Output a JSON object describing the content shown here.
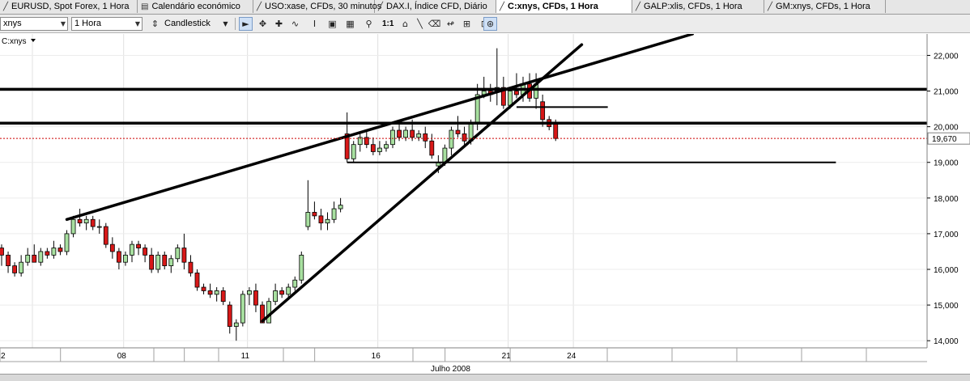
{
  "tabs": [
    {
      "label": "EURUSD, Spot Forex, 1 Hora",
      "icon": "chart-icon",
      "active": false
    },
    {
      "label": "Calendário económico",
      "icon": "calendar-icon",
      "active": false
    },
    {
      "label": "USO:xase, CFDs, 30 minutos",
      "icon": "chart-icon",
      "active": false
    },
    {
      "label": "DAX.I, Índice CFD, Diário",
      "icon": "chart-icon",
      "active": false
    },
    {
      "label": "C:xnys, CFDs, 1 Hora",
      "icon": "chart-icon",
      "active": true
    },
    {
      "label": "GALP:xlis, CFDs, 1 Hora",
      "icon": "chart-icon",
      "active": false
    },
    {
      "label": "GM:xnys, CFDs, 1 Hora",
      "icon": "chart-icon",
      "active": false
    }
  ],
  "toolbar": {
    "symbol": "xnys",
    "timeframe": "1 Hora",
    "chart_type": "Candlestick",
    "zoom_ratio": "1:1"
  },
  "chart_data": {
    "type": "candlestick",
    "symbol_label": "C:xnys",
    "ylim": [
      13.8,
      22.6
    ],
    "y_ticks": [
      "22,000",
      "21,000",
      "20,000",
      "19,000",
      "18,000",
      "17,000",
      "16,000",
      "15,000",
      "14,000"
    ],
    "y_tick_values": [
      22,
      21,
      20,
      19,
      18,
      17,
      16,
      15,
      14
    ],
    "x_tick_labels": [
      "2",
      "08",
      "11",
      "16",
      "21",
      "24"
    ],
    "x_tick_index": [
      0,
      14,
      33,
      53,
      73,
      83
    ],
    "month_label": "Julho 2008",
    "current_price": 19.67,
    "current_price_label": "19,670",
    "colors": {
      "up": "#a8e0a0",
      "down": "#d81818",
      "price_line": "#cc0000",
      "drawing": "#000000"
    },
    "candles": [
      {
        "o": 16.6,
        "h": 16.7,
        "l": 16.1,
        "c": 16.4
      },
      {
        "o": 16.4,
        "h": 16.5,
        "l": 15.9,
        "c": 16.1
      },
      {
        "o": 16.1,
        "h": 16.2,
        "l": 15.8,
        "c": 15.9
      },
      {
        "o": 15.9,
        "h": 16.4,
        "l": 15.8,
        "c": 16.2
      },
      {
        "o": 16.2,
        "h": 16.6,
        "l": 16.1,
        "c": 16.4
      },
      {
        "o": 16.4,
        "h": 16.7,
        "l": 16.2,
        "c": 16.2
      },
      {
        "o": 16.2,
        "h": 16.6,
        "l": 16.1,
        "c": 16.5
      },
      {
        "o": 16.5,
        "h": 16.6,
        "l": 16.3,
        "c": 16.4
      },
      {
        "o": 16.4,
        "h": 16.8,
        "l": 16.3,
        "c": 16.6
      },
      {
        "o": 16.6,
        "h": 16.7,
        "l": 16.4,
        "c": 16.5
      },
      {
        "o": 16.5,
        "h": 17.1,
        "l": 16.4,
        "c": 17.0
      },
      {
        "o": 17.0,
        "h": 17.5,
        "l": 16.9,
        "c": 17.4
      },
      {
        "o": 17.4,
        "h": 17.7,
        "l": 17.2,
        "c": 17.3
      },
      {
        "o": 17.3,
        "h": 17.5,
        "l": 17.1,
        "c": 17.4
      },
      {
        "o": 17.4,
        "h": 17.5,
        "l": 17.1,
        "c": 17.2
      },
      {
        "o": 17.2,
        "h": 17.4,
        "l": 17.0,
        "c": 17.2
      },
      {
        "o": 17.2,
        "h": 17.3,
        "l": 16.6,
        "c": 16.7
      },
      {
        "o": 16.7,
        "h": 16.9,
        "l": 16.3,
        "c": 16.5
      },
      {
        "o": 16.5,
        "h": 16.6,
        "l": 16.0,
        "c": 16.2
      },
      {
        "o": 16.2,
        "h": 16.5,
        "l": 16.1,
        "c": 16.4
      },
      {
        "o": 16.4,
        "h": 16.8,
        "l": 16.2,
        "c": 16.7
      },
      {
        "o": 16.7,
        "h": 16.8,
        "l": 16.4,
        "c": 16.6
      },
      {
        "o": 16.6,
        "h": 16.7,
        "l": 16.2,
        "c": 16.4
      },
      {
        "o": 16.4,
        "h": 16.6,
        "l": 15.9,
        "c": 16.0
      },
      {
        "o": 16.0,
        "h": 16.5,
        "l": 15.9,
        "c": 16.4
      },
      {
        "o": 16.4,
        "h": 16.5,
        "l": 16.0,
        "c": 16.1
      },
      {
        "o": 16.1,
        "h": 16.4,
        "l": 15.9,
        "c": 16.3
      },
      {
        "o": 16.3,
        "h": 16.7,
        "l": 16.2,
        "c": 16.6
      },
      {
        "o": 16.6,
        "h": 17.0,
        "l": 16.0,
        "c": 16.2
      },
      {
        "o": 16.2,
        "h": 16.4,
        "l": 15.8,
        "c": 15.9
      },
      {
        "o": 15.9,
        "h": 16.0,
        "l": 15.4,
        "c": 15.5
      },
      {
        "o": 15.5,
        "h": 15.6,
        "l": 15.3,
        "c": 15.4
      },
      {
        "o": 15.4,
        "h": 15.6,
        "l": 15.2,
        "c": 15.3
      },
      {
        "o": 15.3,
        "h": 15.5,
        "l": 15.1,
        "c": 15.4
      },
      {
        "o": 15.4,
        "h": 15.5,
        "l": 15.0,
        "c": 15.1
      },
      {
        "o": 15.0,
        "h": 15.1,
        "l": 14.2,
        "c": 14.4
      },
      {
        "o": 14.4,
        "h": 14.6,
        "l": 14.0,
        "c": 14.5
      },
      {
        "o": 14.5,
        "h": 15.4,
        "l": 14.4,
        "c": 15.3
      },
      {
        "o": 15.3,
        "h": 15.5,
        "l": 15.0,
        "c": 15.4
      },
      {
        "o": 15.4,
        "h": 15.6,
        "l": 14.8,
        "c": 15.0
      },
      {
        "o": 15.0,
        "h": 15.1,
        "l": 14.5,
        "c": 14.5
      },
      {
        "o": 14.5,
        "h": 15.2,
        "l": 14.5,
        "c": 15.1
      },
      {
        "o": 15.1,
        "h": 15.6,
        "l": 15.0,
        "c": 15.4
      },
      {
        "o": 15.4,
        "h": 15.5,
        "l": 15.2,
        "c": 15.3
      },
      {
        "o": 15.3,
        "h": 15.6,
        "l": 15.2,
        "c": 15.5
      },
      {
        "o": 15.5,
        "h": 15.8,
        "l": 15.4,
        "c": 15.7
      },
      {
        "o": 15.7,
        "h": 16.5,
        "l": 15.6,
        "c": 16.4
      },
      {
        "o": 17.2,
        "h": 18.5,
        "l": 17.1,
        "c": 17.6
      },
      {
        "o": 17.6,
        "h": 17.9,
        "l": 17.4,
        "c": 17.5
      },
      {
        "o": 17.5,
        "h": 17.7,
        "l": 17.1,
        "c": 17.3
      },
      {
        "o": 17.3,
        "h": 17.6,
        "l": 17.1,
        "c": 17.4
      },
      {
        "o": 17.4,
        "h": 17.9,
        "l": 17.3,
        "c": 17.7
      },
      {
        "o": 17.7,
        "h": 18.0,
        "l": 17.6,
        "c": 17.8
      },
      {
        "o": 19.8,
        "h": 20.4,
        "l": 19.0,
        "c": 19.1
      },
      {
        "o": 19.1,
        "h": 19.6,
        "l": 19.0,
        "c": 19.5
      },
      {
        "o": 19.5,
        "h": 19.8,
        "l": 19.3,
        "c": 19.7
      },
      {
        "o": 19.7,
        "h": 19.9,
        "l": 19.4,
        "c": 19.5
      },
      {
        "o": 19.5,
        "h": 19.7,
        "l": 19.2,
        "c": 19.3
      },
      {
        "o": 19.3,
        "h": 19.6,
        "l": 19.2,
        "c": 19.4
      },
      {
        "o": 19.4,
        "h": 19.6,
        "l": 19.3,
        "c": 19.5
      },
      {
        "o": 19.5,
        "h": 20.0,
        "l": 19.4,
        "c": 19.9
      },
      {
        "o": 19.9,
        "h": 20.1,
        "l": 19.6,
        "c": 19.7
      },
      {
        "o": 19.7,
        "h": 20.0,
        "l": 19.6,
        "c": 19.9
      },
      {
        "o": 19.9,
        "h": 20.2,
        "l": 19.6,
        "c": 19.7
      },
      {
        "o": 19.7,
        "h": 19.9,
        "l": 19.6,
        "c": 19.8
      },
      {
        "o": 19.8,
        "h": 20.0,
        "l": 19.4,
        "c": 19.6
      },
      {
        "o": 19.6,
        "h": 19.8,
        "l": 19.1,
        "c": 19.2
      },
      {
        "o": 18.9,
        "h": 19.2,
        "l": 18.7,
        "c": 19.0
      },
      {
        "o": 19.0,
        "h": 19.5,
        "l": 18.9,
        "c": 19.4
      },
      {
        "o": 19.4,
        "h": 20.0,
        "l": 19.2,
        "c": 19.9
      },
      {
        "o": 19.9,
        "h": 20.3,
        "l": 19.7,
        "c": 19.8
      },
      {
        "o": 19.8,
        "h": 20.0,
        "l": 19.5,
        "c": 19.6
      },
      {
        "o": 19.6,
        "h": 20.2,
        "l": 19.5,
        "c": 20.1
      },
      {
        "o": 20.1,
        "h": 21.2,
        "l": 19.9,
        "c": 20.9
      },
      {
        "o": 20.9,
        "h": 21.4,
        "l": 20.8,
        "c": 21.0
      },
      {
        "o": 21.0,
        "h": 21.2,
        "l": 20.7,
        "c": 20.9
      },
      {
        "o": 21.0,
        "h": 22.2,
        "l": 20.6,
        "c": 21.1
      },
      {
        "o": 21.1,
        "h": 21.4,
        "l": 20.5,
        "c": 20.6
      },
      {
        "o": 20.6,
        "h": 21.1,
        "l": 20.5,
        "c": 21.0
      },
      {
        "o": 21.0,
        "h": 21.5,
        "l": 20.8,
        "c": 20.9
      },
      {
        "o": 20.9,
        "h": 21.4,
        "l": 20.7,
        "c": 21.2
      },
      {
        "o": 21.2,
        "h": 21.5,
        "l": 20.7,
        "c": 20.8
      },
      {
        "o": 20.8,
        "h": 21.5,
        "l": 20.5,
        "c": 21.2
      },
      {
        "o": 20.7,
        "h": 20.9,
        "l": 20.0,
        "c": 20.2
      },
      {
        "o": 20.2,
        "h": 20.3,
        "l": 19.9,
        "c": 20.0
      },
      {
        "o": 20.1,
        "h": 20.2,
        "l": 19.6,
        "c": 19.67
      }
    ],
    "trendlines": [
      {
        "i1": 10,
        "y1": 17.4,
        "i2": 106,
        "y2": 22.6
      },
      {
        "i1": 40,
        "y1": 14.55,
        "i2": 89,
        "y2": 22.3
      }
    ],
    "hlines_full": [
      21.05,
      20.1
    ],
    "hlines_segment": [
      {
        "i1": 53,
        "i2": 128,
        "y": 19.0
      },
      {
        "i1": 79,
        "i2": 93,
        "y": 20.55
      }
    ]
  }
}
